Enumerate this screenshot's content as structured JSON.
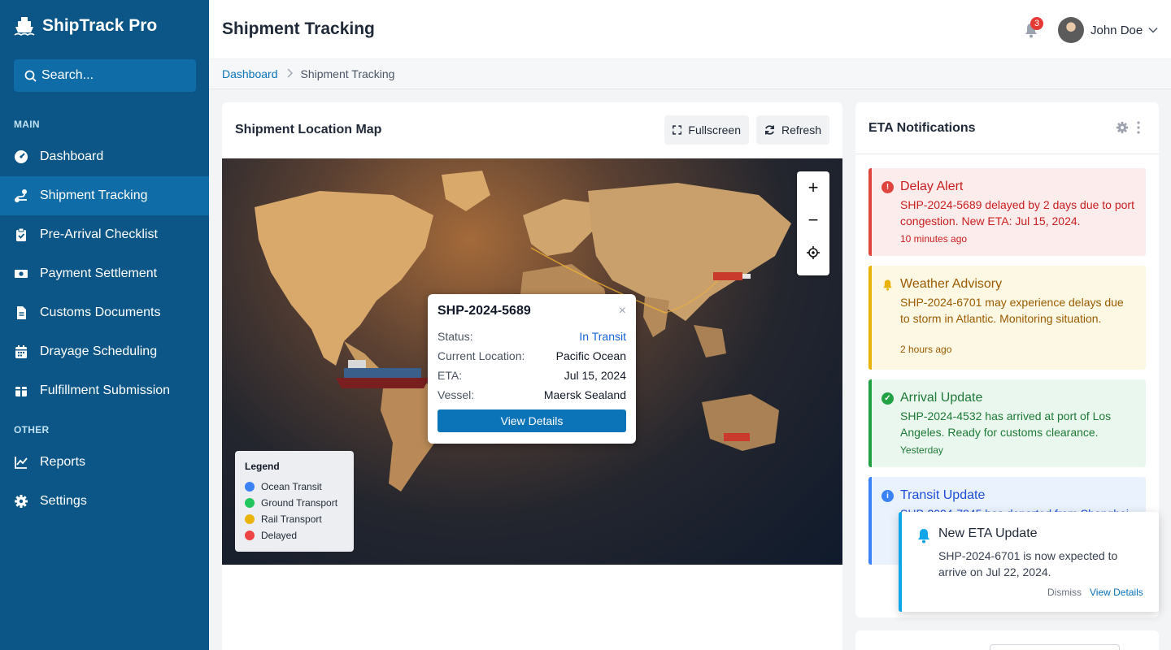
{
  "app": {
    "name": "ShipTrack Pro",
    "search_placeholder": "Search..."
  },
  "sidebar": {
    "sections": [
      {
        "label": "MAIN"
      },
      {
        "label": "OTHER"
      }
    ],
    "items": [
      {
        "label": "Dashboard",
        "icon": "gauge-icon",
        "active": false
      },
      {
        "label": "Shipment Tracking",
        "icon": "route-icon",
        "active": true
      },
      {
        "label": "Pre-Arrival Checklist",
        "icon": "clipboard-check-icon",
        "active": false
      },
      {
        "label": "Payment Settlement",
        "icon": "money-icon",
        "active": false
      },
      {
        "label": "Customs Documents",
        "icon": "document-icon",
        "active": false
      },
      {
        "label": "Drayage Scheduling",
        "icon": "calendar-icon",
        "active": false
      },
      {
        "label": "Fulfillment Submission",
        "icon": "box-icon",
        "active": false
      },
      {
        "label": "Reports",
        "icon": "chart-line-icon",
        "active": false
      },
      {
        "label": "Settings",
        "icon": "gear-icon",
        "active": false
      }
    ]
  },
  "header": {
    "title": "Shipment Tracking",
    "notification_count": "3",
    "user_name": "John Doe"
  },
  "breadcrumb": {
    "home": "Dashboard",
    "current": "Shipment Tracking"
  },
  "map_card": {
    "title": "Shipment Location Map",
    "fullscreen_label": "Fullscreen",
    "refresh_label": "Refresh",
    "popup": {
      "shipment_id": "SHP-2024-5689",
      "close_glyph": "×",
      "rows": [
        {
          "key": "Status:",
          "value": "In Transit"
        },
        {
          "key": "Current Location:",
          "value": "Pacific Ocean"
        },
        {
          "key": "ETA:",
          "value": "Jul 15, 2024"
        },
        {
          "key": "Vessel:",
          "value": "Maersk Sealand"
        }
      ],
      "button_label": "View Details"
    },
    "legend": {
      "title": "Legend",
      "items": [
        {
          "label": "Ocean Transit",
          "color": "#3b82f6"
        },
        {
          "label": "Ground Transport",
          "color": "#22c55e"
        },
        {
          "label": "Rail Transport",
          "color": "#eab308"
        },
        {
          "label": "Delayed",
          "color": "#ef4444"
        }
      ]
    },
    "zoom": {
      "in": "+",
      "out": "−"
    }
  },
  "eta_notifications": {
    "title": "ETA Notifications",
    "items": [
      {
        "title": "Delay Alert",
        "body": "SHP-2024-5689 delayed by 2 days due to port congestion. New ETA: Jul 15, 2024.",
        "time": "10 minutes ago",
        "kind": "danger"
      },
      {
        "title": "Weather Advisory",
        "body": "SHP-2024-6701 may experience delays due to storm in Atlantic. Monitoring situation.",
        "time": "2 hours ago",
        "kind": "warning"
      },
      {
        "title": "Arrival Update",
        "body": "SHP-2024-4532 has arrived at port of Los Angeles. Ready for customs clearance.",
        "time": "Yesterday",
        "kind": "success"
      },
      {
        "title": "Transit Update",
        "body": "SHP-2024-7845 has departed from Shanghai",
        "kind": "info"
      }
    ]
  },
  "toast": {
    "title": "New ETA Update",
    "body": "SHP-2024-6701 is now expected to arrive on Jul 22, 2024.",
    "dismiss_label": "Dismiss",
    "view_label": "View Details"
  }
}
